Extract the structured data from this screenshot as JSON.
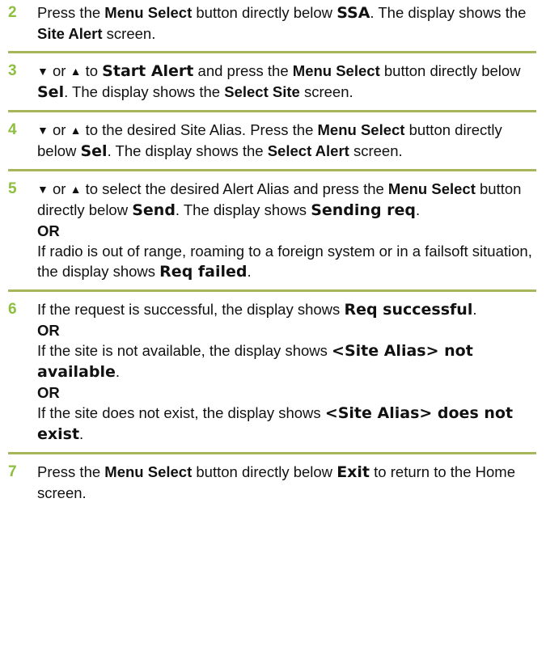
{
  "step2": {
    "num": "2",
    "t1": "Press the ",
    "b1": "Menu Select",
    "t2": " button directly below ",
    "d1": "SSA",
    "t3": ". The display shows the ",
    "b2": "Site Alert",
    "t4": " screen."
  },
  "step3": {
    "num": "3",
    "down_icon": "▼",
    "or_word": " or ",
    "up_icon": "▲",
    "t1": "  to ",
    "d1": "Start Alert",
    "t2": " and press the ",
    "b1": "Menu Select",
    "t3": " button directly below ",
    "d2": "Sel",
    "t4": ". The display shows the ",
    "b2": "Select Site",
    "t5": " screen."
  },
  "step4": {
    "num": "4",
    "down_icon": "▼",
    "or_word": " or ",
    "up_icon": "▲",
    "t1": "  to the desired Site Alias. Press the ",
    "b1": "Menu Select",
    "t2": " button directly below ",
    "d1": "Sel",
    "t3": ". The display shows the ",
    "b2": "Select Alert",
    "t4": " screen."
  },
  "step5": {
    "num": "5",
    "down_icon": "▼",
    "or_word": " or ",
    "up_icon": "▲",
    "t1": "  to select the desired Alert Alias and press the ",
    "b1": "Menu Select",
    "t2": " button directly below ",
    "d1": "Send",
    "t3": ". The display shows ",
    "d2": "Sending req",
    "t4": ".",
    "or": "OR",
    "t5": "If radio is out of range, roaming to a foreign system or in a failsoft situation, the display shows ",
    "d3": "Req failed",
    "t6": "."
  },
  "step6": {
    "num": "6",
    "t1": "If the request is successful, the display shows ",
    "d1": "Req successful",
    "t2": ".",
    "or1": "OR",
    "t3": "If the site is not available, the display shows ",
    "d2": "<Site Alias> not available",
    "t4": ".",
    "or2": "OR",
    "t5": "If the site does not exist, the display shows ",
    "d3": "<Site Alias> does not exist",
    "t6": "."
  },
  "step7": {
    "num": "7",
    "t1": "Press the ",
    "b1": "Menu Select",
    "t2": " button directly below ",
    "d1": "Exit",
    "t3": " to return to the Home screen."
  },
  "colors": {
    "step_number": "#8cbf3f",
    "rule": "#9aa83e"
  }
}
